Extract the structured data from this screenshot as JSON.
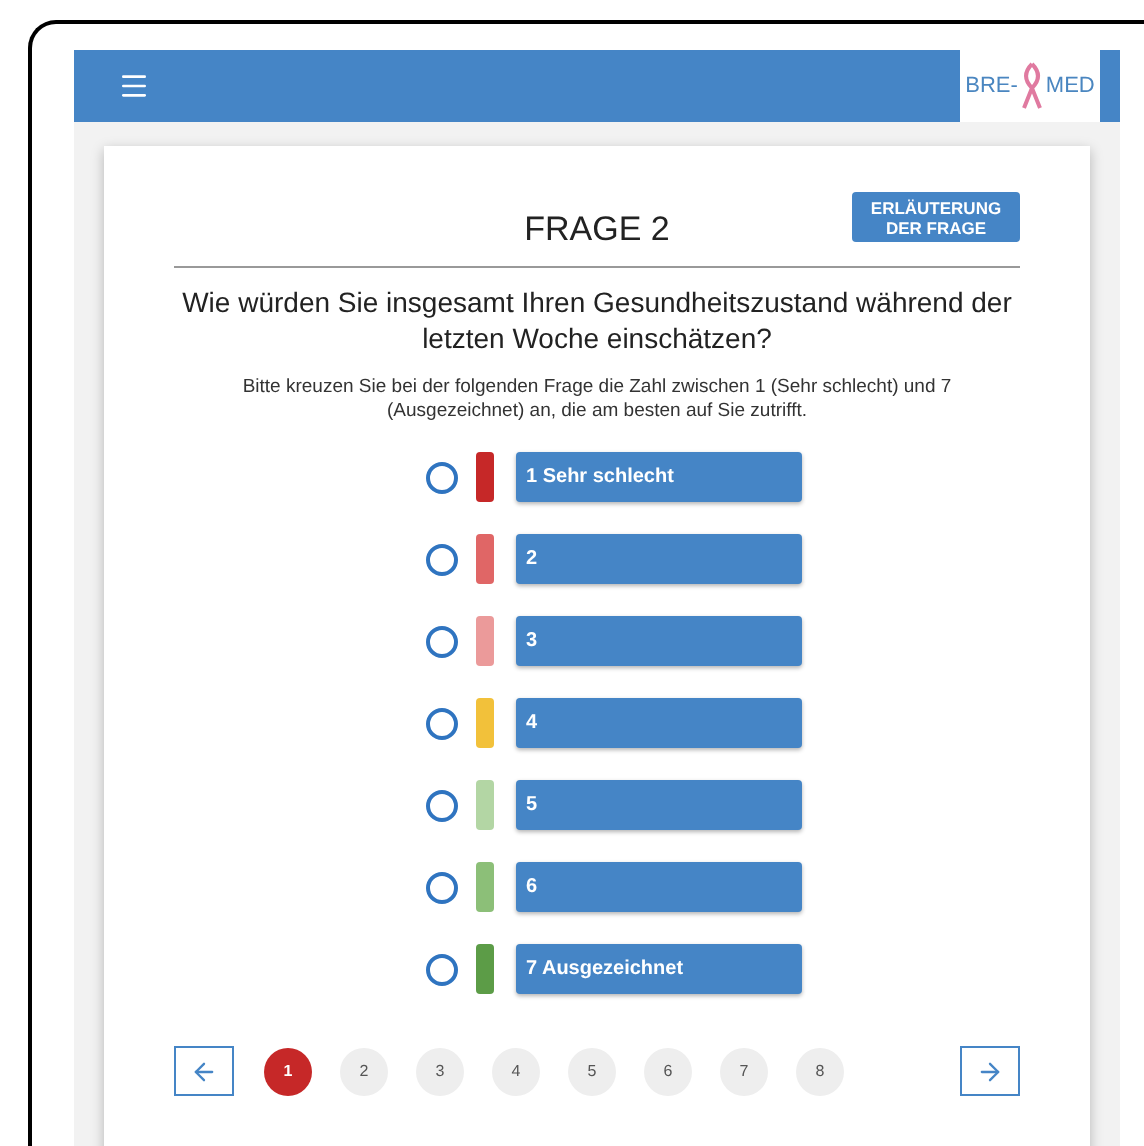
{
  "header": {
    "logo": {
      "left": "BRE-",
      "right": "MED"
    }
  },
  "question": {
    "title": "FRAGE 2",
    "help_button": "ERLÄUTERUNG\nDER FRAGE",
    "text": "Wie würden Sie insgesamt Ihren Gesundheitszustand während der letzten Woche einschätzen?",
    "instruction": "Bitte kreuzen Sie bei der folgenden Frage die Zahl zwischen 1 (Sehr schlecht) und 7 (Ausgezeichnet) an, die am besten auf Sie zutrifft."
  },
  "options": [
    {
      "label": "1 Sehr schlecht",
      "color": "#c62828",
      "selected": false
    },
    {
      "label": "2",
      "color": "#e06666",
      "selected": false
    },
    {
      "label": "3",
      "color": "#eb9a9a",
      "selected": false
    },
    {
      "label": "4",
      "color": "#f2c13a",
      "selected": false
    },
    {
      "label": "5",
      "color": "#b3d6a4",
      "selected": false
    },
    {
      "label": "6",
      "color": "#8cbf78",
      "selected": false
    },
    {
      "label": "7 Ausgezeichnet",
      "color": "#5c9c47",
      "selected": false
    }
  ],
  "pagination": {
    "pages": [
      {
        "label": "1",
        "selected": true
      },
      {
        "label": "2",
        "selected": false
      },
      {
        "label": "3",
        "selected": false
      },
      {
        "label": "4",
        "selected": false
      },
      {
        "label": "5",
        "selected": false
      },
      {
        "label": "6",
        "selected": false
      },
      {
        "label": "7",
        "selected": false
      },
      {
        "label": "8",
        "selected": false
      }
    ]
  }
}
